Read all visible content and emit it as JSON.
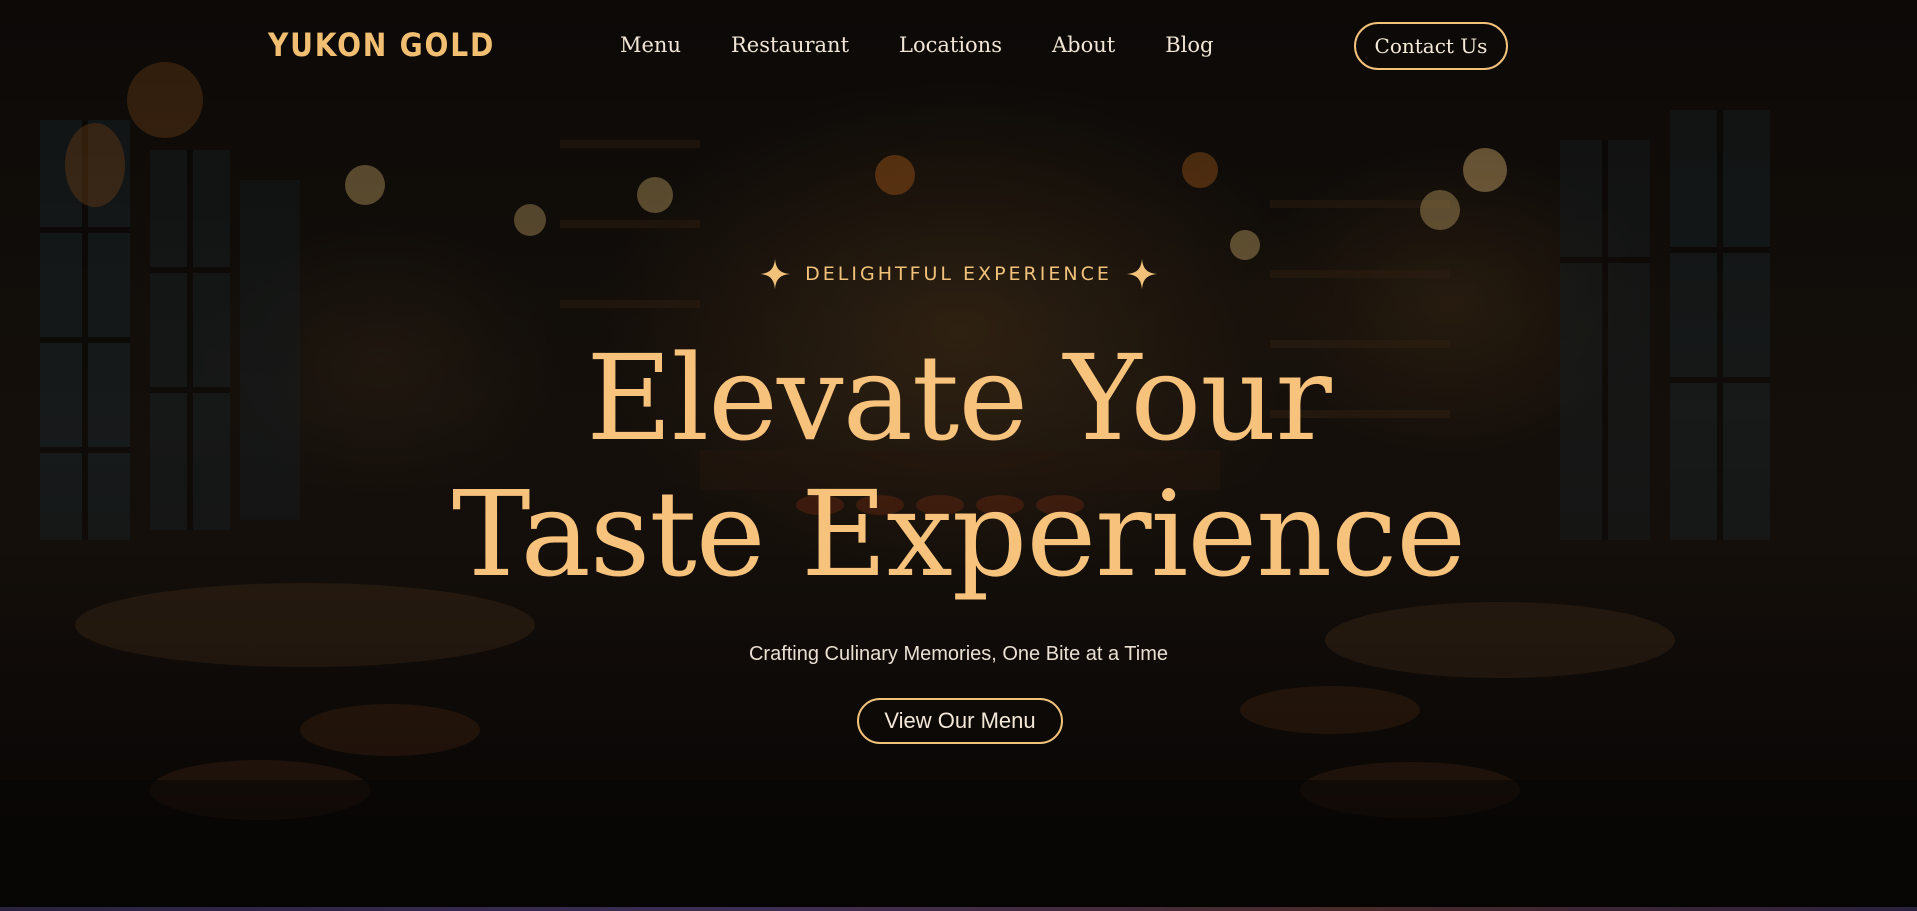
{
  "header": {
    "logo": "YUKON GOLD",
    "nav": [
      "Menu",
      "Restaurant",
      "Locations",
      "About",
      "Blog"
    ],
    "contact_label": "Contact Us"
  },
  "hero": {
    "eyebrow": "DELIGHTFUL EXPERIENCE",
    "headline_line1": "Elevate Your",
    "headline_line2": "Taste Experience",
    "subtitle": "Crafting Culinary Memories, One Bite at a Time",
    "cta_label": "View Our Menu"
  },
  "colors": {
    "accent_gold": "#f2c27a",
    "headline_gold": "#f6c27c",
    "text_light": "#f1e6d6",
    "background_dark": "#0b0908"
  },
  "icons": {
    "eyebrow_left": "sparkle-icon",
    "eyebrow_right": "sparkle-icon"
  }
}
